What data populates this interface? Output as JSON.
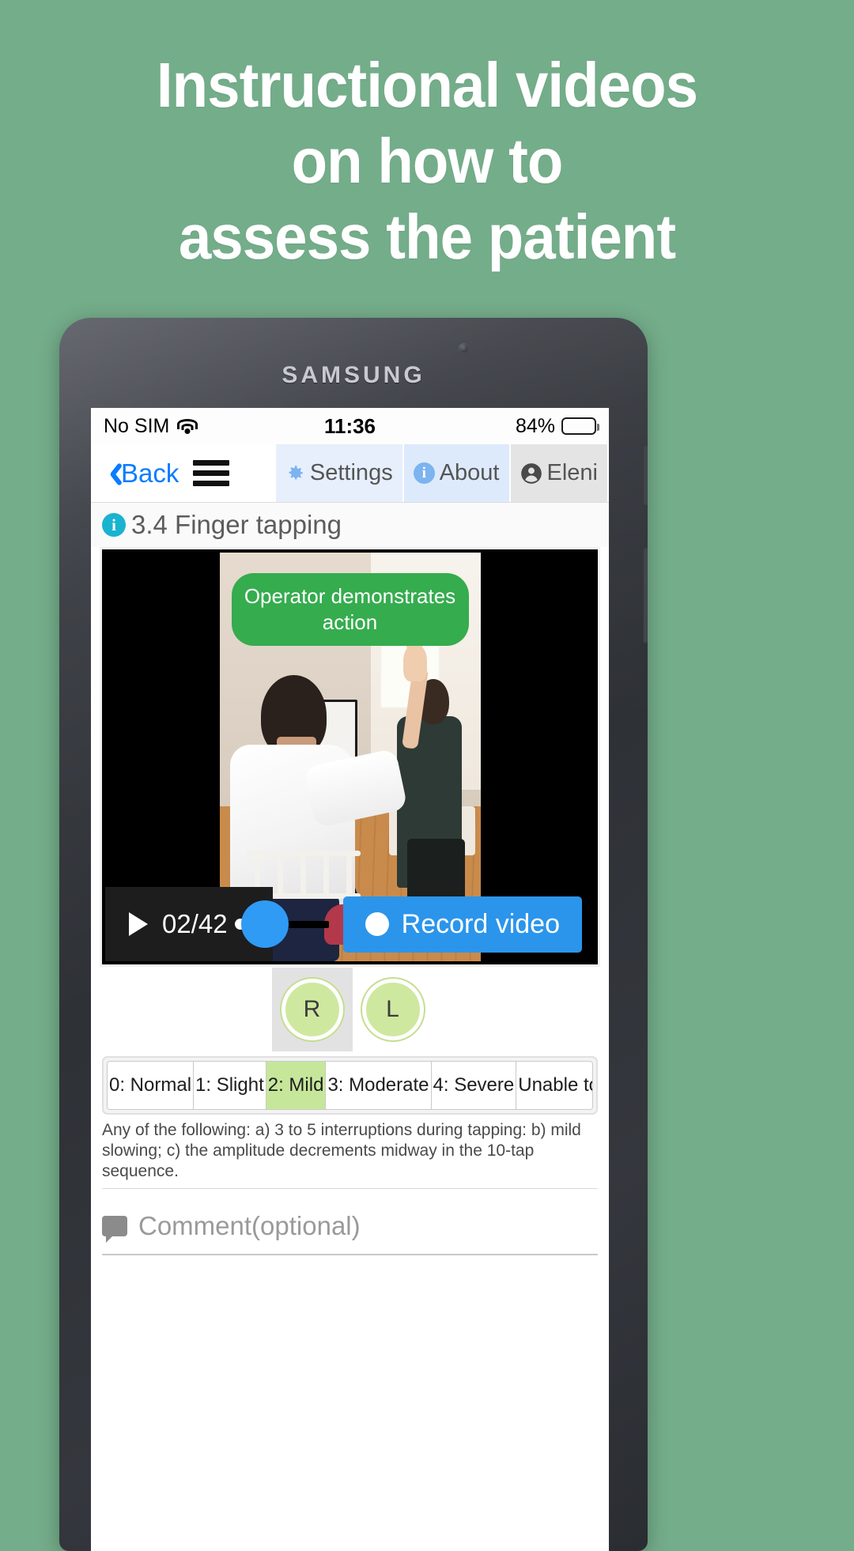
{
  "headline": {
    "line1": "Instructional videos",
    "line2": "on how to",
    "line3": "assess the patient"
  },
  "device": {
    "brand": "SAMSUNG"
  },
  "statusbar": {
    "carrier": "No SIM",
    "wifi_icon": "wifi-icon",
    "time": "11:36",
    "battery_percent": "84%",
    "battery_icon": "battery-icon"
  },
  "toolbar": {
    "back_label": "Back",
    "back_icon": "chevron-left-icon",
    "menu_icon": "hamburger-menu-icon",
    "settings_label": "Settings",
    "settings_icon": "gear-icon",
    "about_label": "About",
    "about_icon": "info-icon",
    "user_label": "Eleni",
    "user_icon": "person-icon"
  },
  "section": {
    "info_icon": "info-icon",
    "info_glyph": "i",
    "title": "3.4 Finger tapping"
  },
  "video": {
    "overlay_label": "Operator demonstrates action",
    "play_icon": "play-icon",
    "timecode": "02/42",
    "record_label": "Record video",
    "record_icon": "record-dot-icon"
  },
  "side_select": {
    "options": [
      {
        "label": "R",
        "selected": true
      },
      {
        "label": "L",
        "selected": false
      }
    ]
  },
  "rating": {
    "options": [
      {
        "label": "0: Normal",
        "selected": false
      },
      {
        "label": "1: Slight",
        "selected": false
      },
      {
        "label": "2: Mild",
        "selected": true
      },
      {
        "label": "3: Moderate",
        "selected": false
      },
      {
        "label": "4: Severe",
        "selected": false
      },
      {
        "label": "Unable to rate",
        "selected": false
      }
    ],
    "description_line1": "Any of the following: a) 3 to 5 interruptions during tapping: b) mild slowing; c)",
    "description_line2": "the amplitude decrements midway in the 10-tap sequence."
  },
  "comment": {
    "icon": "comment-bubble-icon",
    "placeholder": "Comment(optional)"
  },
  "colors": {
    "background_green": "#74ad8a",
    "accent_blue": "#0a7cff",
    "record_blue": "#2b95eb",
    "overlay_green": "#35ac4e",
    "selected_green": "#c6e79a",
    "info_teal": "#19b3d0"
  }
}
